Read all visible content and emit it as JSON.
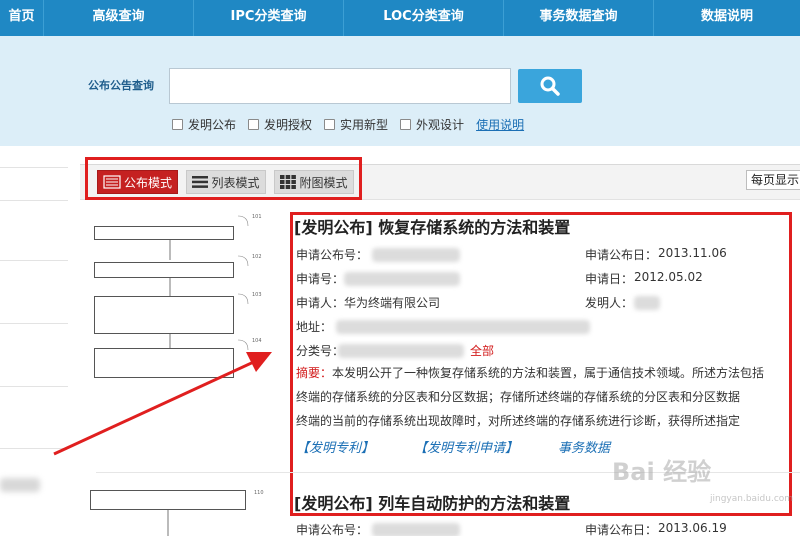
{
  "nav": {
    "items": [
      "首页",
      "高级查询",
      "IPC分类查询",
      "LOC分类查询",
      "事务数据查询",
      "数据说明"
    ]
  },
  "search": {
    "label": "公布公告查询",
    "value": "",
    "placeholder": "",
    "checkboxes": [
      "发明公布",
      "发明授权",
      "实用新型",
      "外观设计"
    ],
    "help_link": "使用说明"
  },
  "modes": {
    "items": [
      "公布模式",
      "列表模式",
      "附图模式"
    ],
    "active_index": 0,
    "per_page": "每页显示"
  },
  "result1": {
    "title": "[发明公布] 恢复存储系统的方法和装置",
    "pub_no_label": "申请公布号：",
    "pub_date_label": "申请公布日：",
    "pub_date": "2013.11.06",
    "app_no_label": "申请号：",
    "app_date_label": "申请日：",
    "app_date": "2012.05.02",
    "applicant_label": "申请人：",
    "applicant": "华为终端有限公司",
    "inventor_label": "发明人：",
    "address_label": "地址：",
    "class_label": "分类号：",
    "class_all": "全部",
    "abstract_label": "摘要：",
    "abstract_lines": [
      "本发明公开了一种恢复存储系统的方法和装置，属于通信技术领域。所述方法包括",
      "终端的存储系统的分区表和分区数据；存储所述终端的存储系统的分区表和分区数据",
      "终端的当前的存储系统出现故障时，对所述终端的存储系统进行诊断，获得所述指定"
    ],
    "links": [
      "【发明专利】",
      "【发明专利申请】",
      "事务数据"
    ]
  },
  "result2": {
    "title": "[发明公布] 列车自动防护的方法和装置",
    "pub_no_label": "申请公布号：",
    "pub_date_label": "申请公布日：",
    "pub_date": "2013.06.19"
  },
  "watermark": {
    "text": "Bai 经验",
    "sub": "jingyan.baidu.com"
  },
  "colors": {
    "nav_bg": "#1f88c4",
    "search_bg": "#dceef8",
    "highlight_red": "#e01f1f",
    "active_mode": "#c52121",
    "link_blue": "#1b6fb5"
  }
}
